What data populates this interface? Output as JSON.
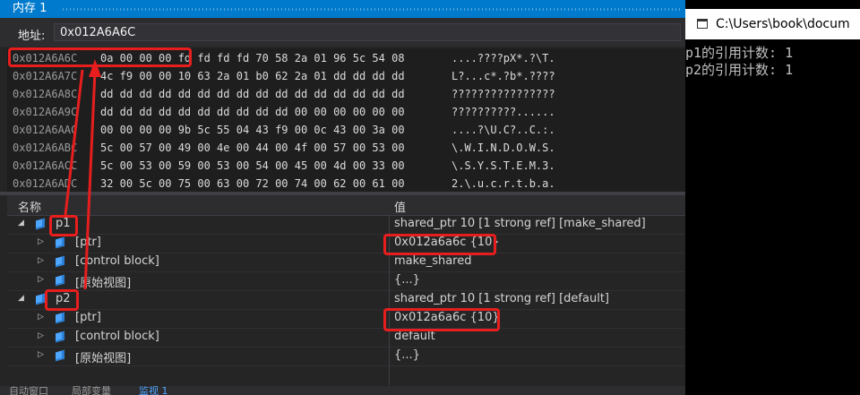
{
  "memory_window": {
    "title": "内存 1",
    "address_label": "地址:",
    "address_value": "0x012A6A6C",
    "rows": [
      {
        "addr": "0x012A6A6C",
        "bytes": "0a 00 00 00 fd fd fd fd 70 58 2a 01 96 5c 54 08",
        "ascii": "....????pX*.?\\T."
      },
      {
        "addr": "0x012A6A7C",
        "bytes": "4c f9 00 00 10 63 2a 01 b0 62 2a 01 dd dd dd dd",
        "ascii": "L?...c*.?b*.????"
      },
      {
        "addr": "0x012A6A8C",
        "bytes": "dd dd dd dd dd dd dd dd dd dd dd dd dd dd dd dd",
        "ascii": "????????????????"
      },
      {
        "addr": "0x012A6A9C",
        "bytes": "dd dd dd dd dd dd dd dd dd dd 00 00 00 00 00 00",
        "ascii": "??????????......"
      },
      {
        "addr": "0x012A6AAC",
        "bytes": "00 00 00 00 9b 5c 55 04 43 f9 00 0c 43 00 3a 00",
        "ascii": "....?\\U.C?..C.:."
      },
      {
        "addr": "0x012A6ABC",
        "bytes": "5c 00 57 00 49 00 4e 00 44 00 4f 00 57 00 53 00",
        "ascii": "\\.W.I.N.D.O.W.S."
      },
      {
        "addr": "0x012A6ACC",
        "bytes": "5c 00 53 00 59 00 53 00 54 00 45 00 4d 00 33 00",
        "ascii": "\\.S.Y.S.T.E.M.3."
      },
      {
        "addr": "0x012A6ADC",
        "bytes": "32 00 5c 00 75 00 63 00 72 00 74 00 62 00 61 00",
        "ascii": "2.\\.u.c.r.t.b.a."
      }
    ]
  },
  "watch_window": {
    "col_name": "名称",
    "col_value": "值",
    "rows": [
      {
        "name": "p1",
        "value": "shared_ptr 10 [1 strong ref] [make_shared]"
      },
      {
        "name": "[ptr]",
        "value": "0x012a6a6c {10}"
      },
      {
        "name": "[control block]",
        "value": "make_shared"
      },
      {
        "name": "[原始视图]",
        "value": "{...}"
      },
      {
        "name": "p2",
        "value": "shared_ptr 10 [1 strong ref] [default]"
      },
      {
        "name": "[ptr]",
        "value": "0x012a6a6c {10}"
      },
      {
        "name": "[control block]",
        "value": "default"
      },
      {
        "name": "[原始视图]",
        "value": "{...}"
      }
    ]
  },
  "bottom_tabs": [
    "自动窗口",
    "局部变量",
    "监视 1"
  ],
  "console": {
    "title": "C:\\Users\\book\\docum",
    "lines": [
      "p1的引用计数: 1",
      "p2的引用计数: 1"
    ]
  },
  "colors": {
    "highlight": "#e81e1e",
    "title_bar": "#007acc",
    "console_bg": "#000000"
  }
}
